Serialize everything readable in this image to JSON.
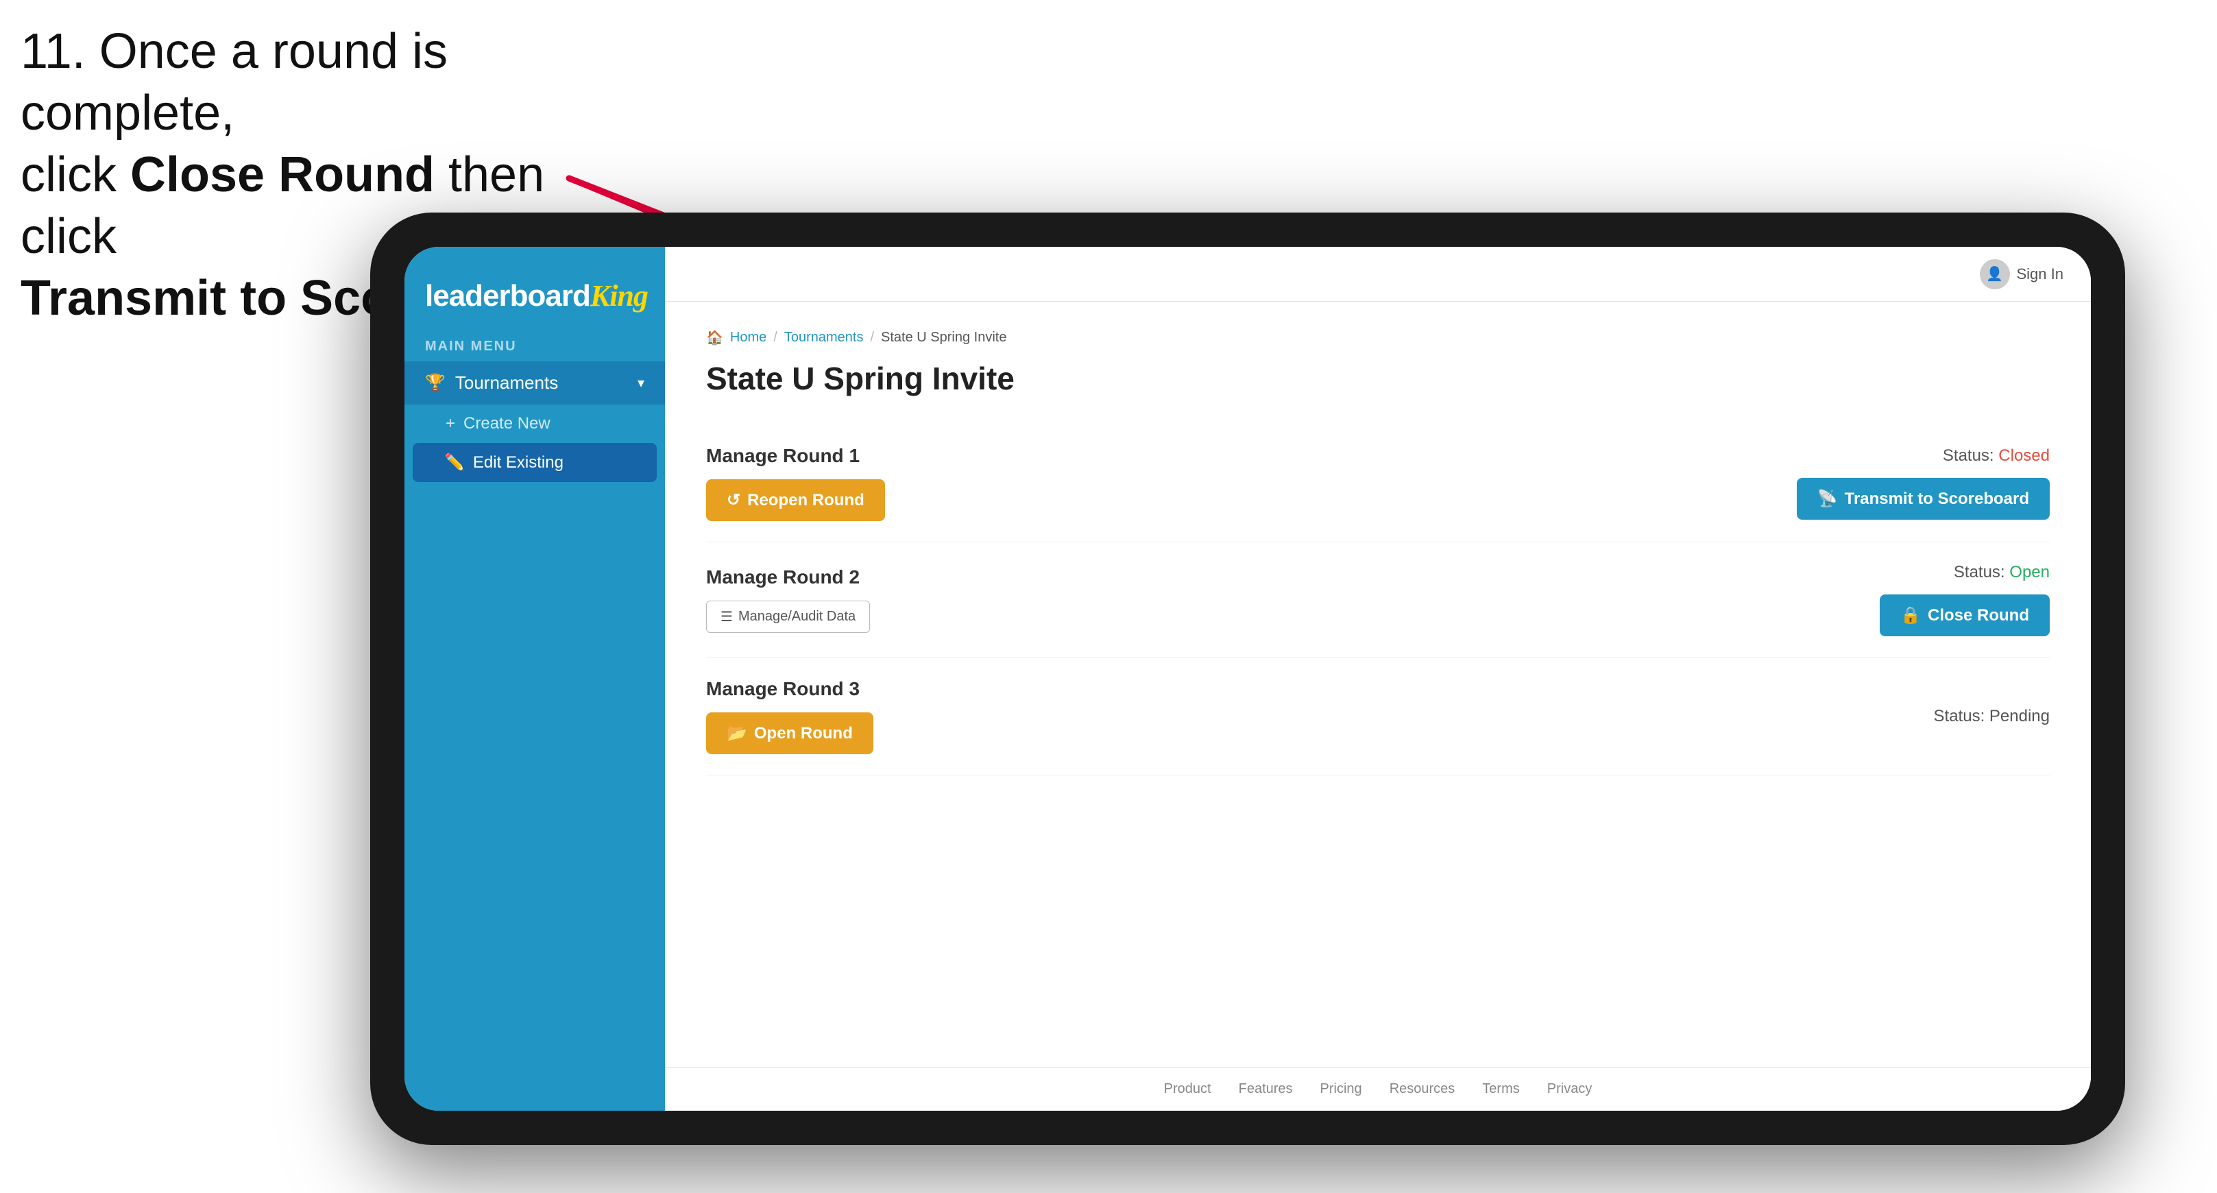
{
  "instruction": {
    "line1": "11. Once a round is complete,",
    "line2": "click ",
    "bold1": "Close Round",
    "line3": " then click",
    "bold2": "Transmit to Scoreboard."
  },
  "logo": {
    "leaderboard": "leaderboard",
    "king": "King"
  },
  "sidebar": {
    "menu_label": "MAIN MENU",
    "tournaments_label": "Tournaments",
    "create_new_label": "Create New",
    "edit_existing_label": "Edit Existing"
  },
  "topbar": {
    "sign_in": "Sign In"
  },
  "breadcrumb": {
    "home": "Home",
    "tournaments": "Tournaments",
    "current": "State U Spring Invite"
  },
  "page": {
    "title": "State U Spring Invite",
    "round1": {
      "title": "Manage Round 1",
      "status_label": "Status:",
      "status_value": "Closed",
      "reopen_btn": "Reopen Round",
      "transmit_btn": "Transmit to Scoreboard"
    },
    "round2": {
      "title": "Manage Round 2",
      "status_label": "Status:",
      "status_value": "Open",
      "audit_btn": "Manage/Audit Data",
      "close_btn": "Close Round"
    },
    "round3": {
      "title": "Manage Round 3",
      "status_label": "Status:",
      "status_value": "Pending",
      "open_btn": "Open Round"
    }
  },
  "footer": {
    "links": [
      "Product",
      "Features",
      "Pricing",
      "Resources",
      "Terms",
      "Privacy"
    ]
  }
}
